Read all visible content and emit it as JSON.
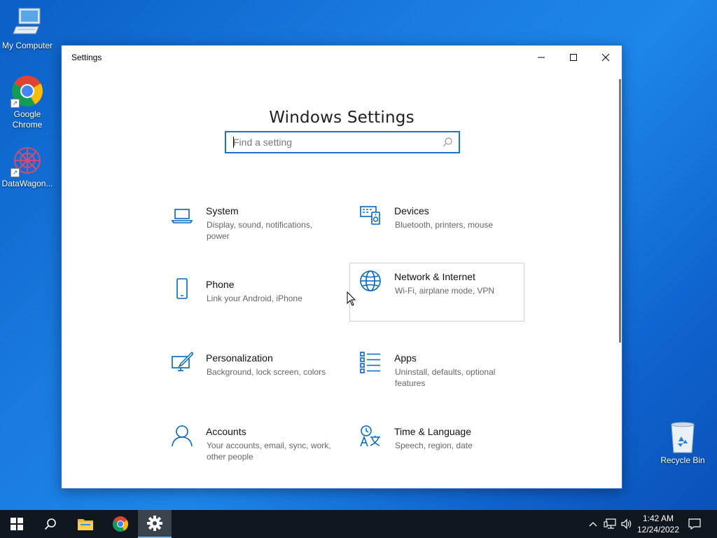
{
  "desktop": {
    "icons": [
      {
        "label": "My Computer",
        "icon": "computer-icon"
      },
      {
        "label": "Google Chrome",
        "icon": "chrome-icon"
      },
      {
        "label": "DataWagon...",
        "icon": "datawagon-icon"
      },
      {
        "label": "Recycle Bin",
        "icon": "recycle-bin-icon"
      }
    ]
  },
  "window": {
    "title": "Settings",
    "heading": "Windows Settings",
    "search": {
      "placeholder": "Find a setting",
      "value": ""
    },
    "controls": [
      "minimize",
      "maximize",
      "close"
    ]
  },
  "categories": [
    {
      "name": "System",
      "desc": "Display, sound, notifications, power",
      "icon": "laptop-icon"
    },
    {
      "name": "Devices",
      "desc": "Bluetooth, printers, mouse",
      "icon": "devices-icon"
    },
    {
      "name": "Phone",
      "desc": "Link your Android, iPhone",
      "icon": "phone-icon"
    },
    {
      "name": "Network & Internet",
      "desc": "Wi-Fi, airplane mode, VPN",
      "icon": "globe-icon",
      "hovered": true
    },
    {
      "name": "Personalization",
      "desc": "Background, lock screen, colors",
      "icon": "personalization-icon"
    },
    {
      "name": "Apps",
      "desc": "Uninstall, defaults, optional features",
      "icon": "apps-icon"
    },
    {
      "name": "Accounts",
      "desc": "Your accounts, email, sync, work, other people",
      "icon": "person-icon"
    },
    {
      "name": "Time & Language",
      "desc": "Speech, region, date",
      "icon": "time-language-icon"
    }
  ],
  "taskbar": {
    "items": [
      "start",
      "search",
      "file-explorer",
      "chrome",
      "settings"
    ],
    "active": "settings",
    "clock": {
      "time": "1:42 AM",
      "date": "12/24/2022"
    }
  },
  "colors": {
    "accent": "#0067c0",
    "desktop": "#1a7be0",
    "taskbar": "#10171f"
  }
}
